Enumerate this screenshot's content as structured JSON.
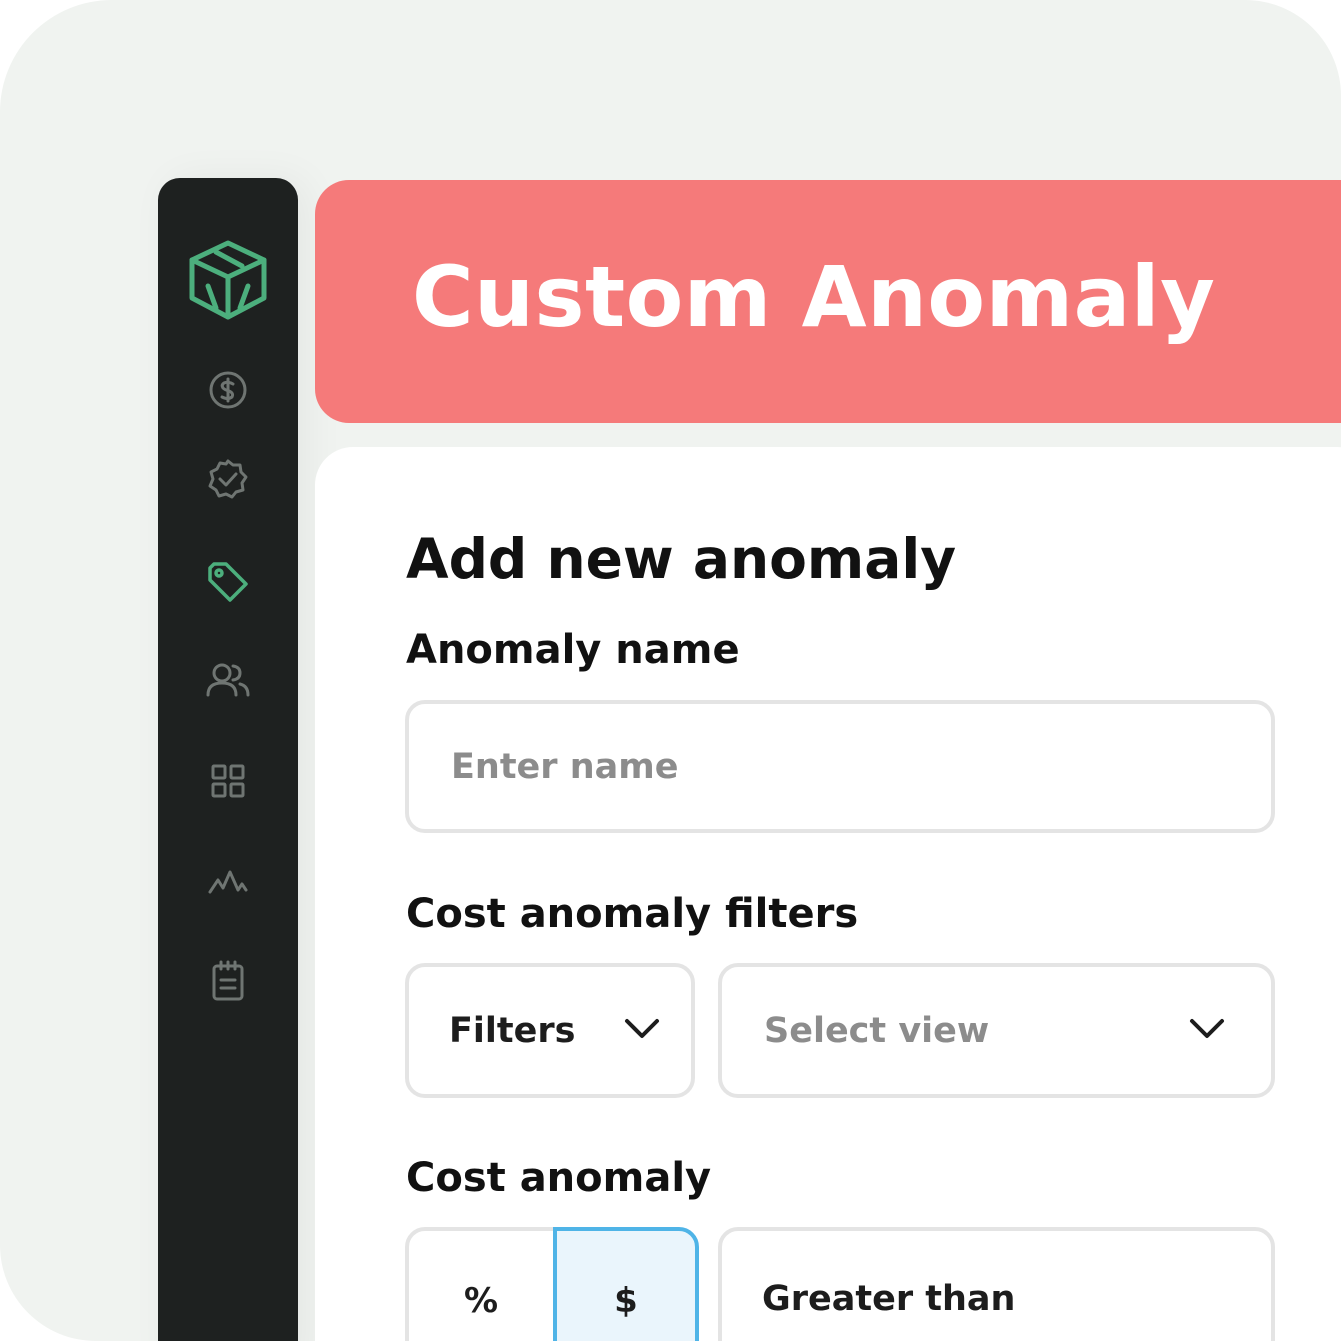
{
  "sidebar": {
    "icons": [
      "cube-logo-icon",
      "dollar-icon",
      "verified-badge-icon",
      "tag-icon",
      "users-icon",
      "grid-icon",
      "activity-icon",
      "notepad-icon"
    ],
    "active_color": "#4caf7d",
    "inactive_color": "#6f7572"
  },
  "banner": {
    "title": "Custom Anomaly",
    "color": "#f57a7a"
  },
  "form": {
    "heading": "Add new anomaly",
    "name_label": "Anomaly name",
    "name_placeholder": "Enter name",
    "filters_label": "Cost  anomaly filters",
    "filters_dropdown": "Filters",
    "view_placeholder": "Select view",
    "cost_label": "Cost anomaly",
    "unit_percent": "%",
    "unit_dollar": "$",
    "unit_selected": "$",
    "comparison": "Greater than"
  },
  "colors": {
    "selected_border": "#4fb4e7",
    "selected_fill": "#eaf5fc"
  }
}
